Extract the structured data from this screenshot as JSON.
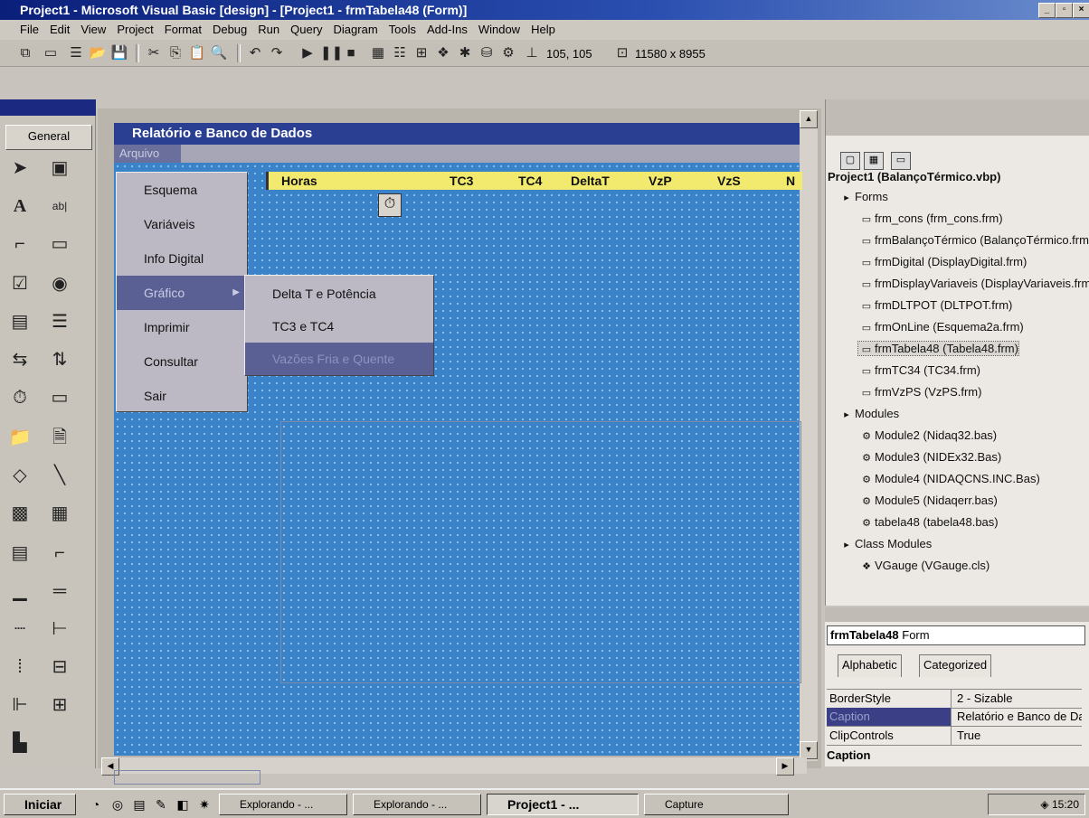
{
  "window": {
    "title": "Project1 - Microsoft Visual Basic [design] - [Project1 - frmTabela48 (Form)]",
    "menu": [
      "File",
      "Edit",
      "View",
      "Project",
      "Format",
      "Debug",
      "Run",
      "Query",
      "Diagram",
      "Tools",
      "Add-Ins",
      "Window",
      "Help"
    ]
  },
  "toolbar": {
    "position": "105, 105",
    "size": "11580 x 8955"
  },
  "toolbox": {
    "tab": "General"
  },
  "form": {
    "caption": "Relatório e Banco de Dados",
    "menu_arquivo": "Arquivo",
    "grid_headers": [
      "Horas",
      "TC3",
      "TC4",
      "DeltaT",
      "VzP",
      "VzS",
      "N"
    ]
  },
  "dropdown": {
    "items": [
      {
        "label": "Esquema"
      },
      {
        "label": "Variáveis"
      },
      {
        "label": "Info Digital"
      },
      {
        "label": "Gráfico"
      },
      {
        "label": "Imprimir"
      },
      {
        "label": "Consultar"
      },
      {
        "label": "Sair"
      }
    ],
    "submenu": [
      "Delta T e Potência",
      "TC3 e TC4",
      "Vazões Fria e Quente"
    ]
  },
  "project": {
    "root": "Project1 (BalançoTérmico.vbp)",
    "forms_label": "Forms",
    "forms": [
      "frm_cons (frm_cons.frm)",
      "frmBalançoTérmico (BalançoTérmico.frm)",
      "frmDigital (DisplayDigital.frm)",
      "frmDisplayVariaveis (DisplayVariaveis.frm)",
      "frmDLTPOT (DLTPOT.frm)",
      "frmOnLine (Esquema2a.frm)",
      "frmTabela48 (Tabela48.frm)",
      "frmTC34 (TC34.frm)",
      "frmVzPS (VzPS.frm)"
    ],
    "modules_label": "Modules",
    "modules": [
      "Module2 (Nidaq32.bas)",
      "Module3 (NIDEx32.Bas)",
      "Module4 (NIDAQCNS.INC.Bas)",
      "Module5 (Nidaqerr.bas)",
      "tabela48 (tabela48.bas)"
    ],
    "class_modules_label": "Class Modules",
    "class_modules": [
      "VGauge (VGauge.cls)"
    ]
  },
  "properties": {
    "object": "frmTabela48",
    "object_type": "Form",
    "tabs": [
      "Alphabetic",
      "Categorized"
    ],
    "rows": [
      {
        "name": "BorderStyle",
        "value": "2 - Sizable"
      },
      {
        "name": "Caption",
        "value": "Relatório e Banco de Dados"
      },
      {
        "name": "ClipControls",
        "value": "True"
      }
    ],
    "caption_label": "Caption"
  },
  "taskbar": {
    "start": "Iniciar",
    "tasks": [
      "Explorando - ...",
      "Explorando - ...",
      "Project1 - ...",
      "Capture"
    ],
    "clock": "15:20"
  },
  "colors": {
    "title_bar": "#0a1f7a",
    "form_client": "#3a83c9",
    "grid_header": "#f2ea6e",
    "menu_highlight": "#5a5f94"
  }
}
